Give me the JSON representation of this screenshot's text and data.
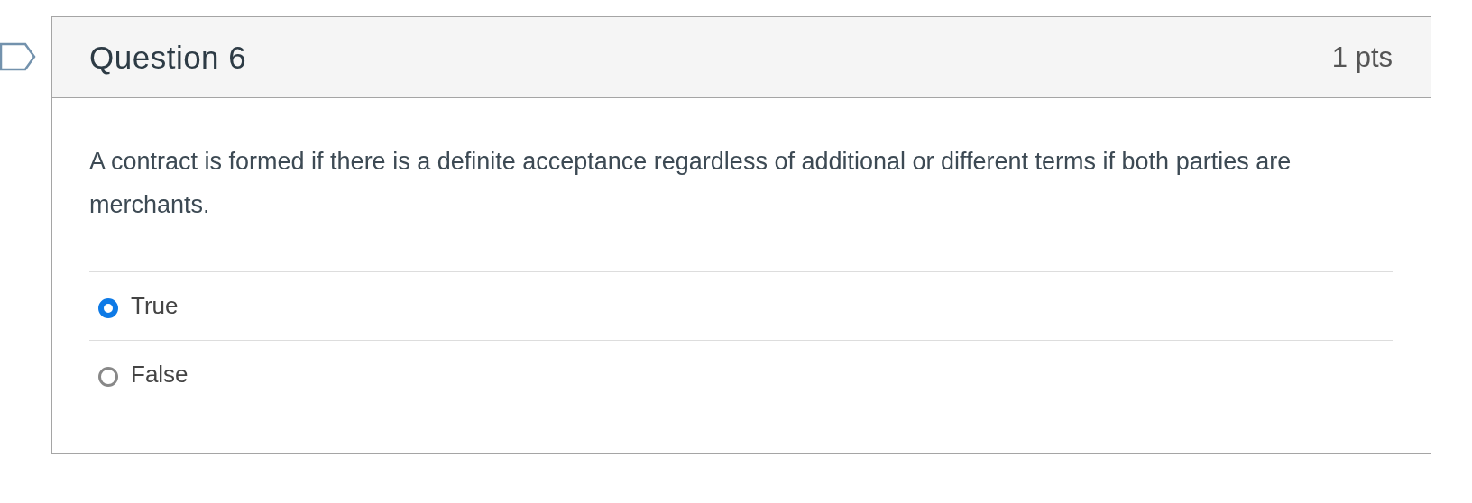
{
  "question": {
    "title": "Question 6",
    "points": "1 pts",
    "text": "A contract is formed if there is a definite acceptance regardless of additional or different terms if both parties are merchants.",
    "answers": [
      {
        "label": "True",
        "selected": true
      },
      {
        "label": "False",
        "selected": false
      }
    ]
  }
}
